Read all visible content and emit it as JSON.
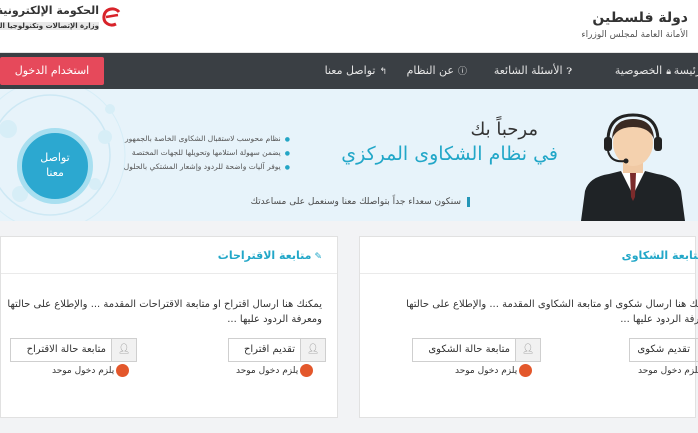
{
  "header": {
    "state_title": "دولة فلسطين",
    "state_subtitle": "الأمانة العامة لمجلس الوزراء",
    "logo_title": "الحكومة الإلكترونية",
    "logo_subtitle": "وزارة الإتصالات وتكنولوجيا المعـ"
  },
  "nav": {
    "items": [
      {
        "label": "الرئيسة",
        "icon": "home-icon"
      },
      {
        "label": "الخصوصية",
        "icon": "lock-icon"
      },
      {
        "label": "الأسئلة الشائعة",
        "icon": "question-icon"
      },
      {
        "label": "عن النظام",
        "icon": "info-icon"
      },
      {
        "label": "تواصل معنا",
        "icon": "reply-icon"
      }
    ],
    "login_label": "استخدام الدخول"
  },
  "banner": {
    "welcome": "مرحباً بك",
    "system_title": "في نظام الشكاوى المركزي",
    "tagline": "سنكون سعداء جداً بتواصلك معنا وسنعمل على مساعدتك",
    "bullets": [
      "نظام محوسب لاستقبال الشكاوى الخاصة بالجمهور",
      "يضمن سهولة استلامها وتحويلها للجهات المختصة",
      "يوفر آليات واضحة للردود وإشعار المشتكي بالحلول"
    ],
    "bubble_line1": "تواصل",
    "bubble_line2": "معنا"
  },
  "complaints": {
    "title": "متابعة الشكاوى",
    "desc_line1": "يمكنك هنا ارسال شكوى او متابعة الشكاوى المقدمة ... والإطلاع على حالتها",
    "desc_line2": "ومعرفة الردود عليها ...",
    "submit_label": "تقديم شكوى",
    "status_label": "متابعة حالة الشكوى",
    "login_required": "يلزم دخول موحد"
  },
  "suggestions": {
    "title": "متابعة الاقتراحات",
    "desc_line1": "يمكنك هنا ارسال اقتراح او متابعة الاقتراحات المقدمة ... والإطلاع على حالتها",
    "desc_line2": "ومعرفة الردود عليها ...",
    "submit_label": "تقديم اقتراح",
    "status_label": "متابعة حالة الاقتراح",
    "login_required": "يلزم دخول موحد"
  },
  "colors": {
    "nav_bg": "#3a3f44",
    "accent": "#22a7c8",
    "login_button": "#e6495b",
    "banner_bg": "#e7f3fa"
  }
}
